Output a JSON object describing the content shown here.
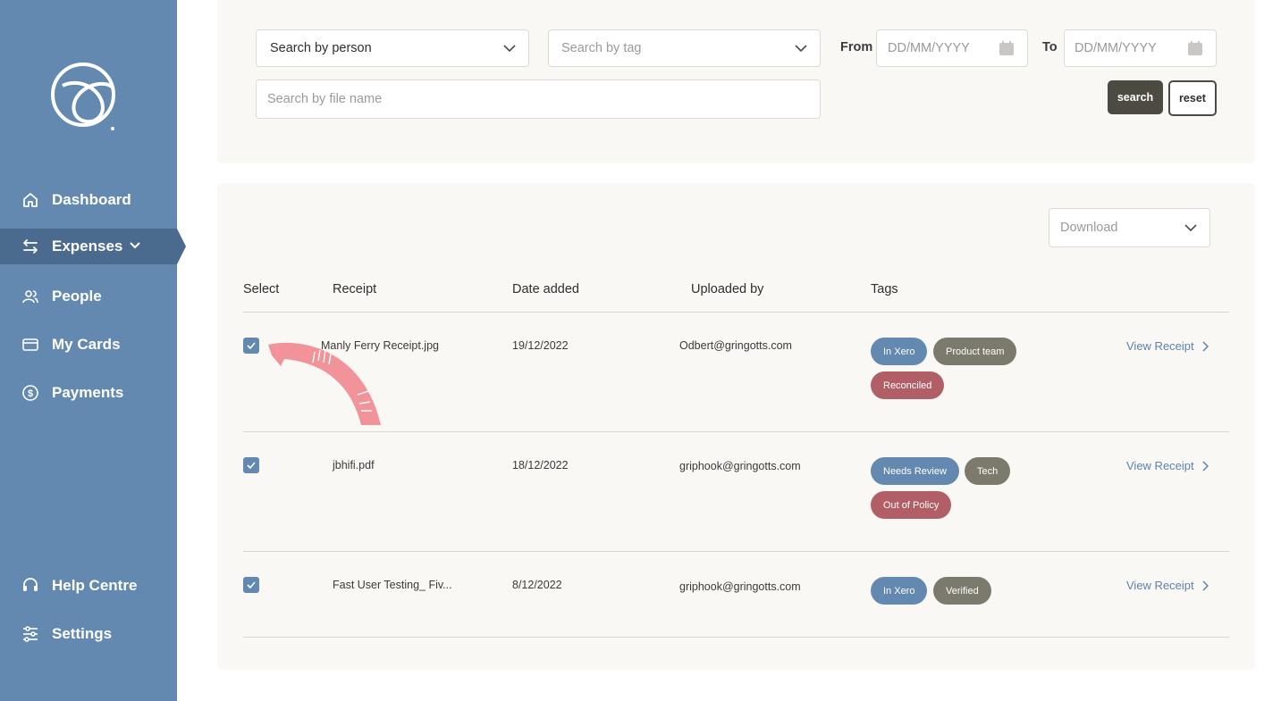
{
  "sidebar": {
    "nav": [
      {
        "label": "Dashboard",
        "icon": "home-icon"
      },
      {
        "label": "Expenses",
        "icon": "transfer-icon"
      },
      {
        "label": "People",
        "icon": "people-icon"
      },
      {
        "label": "My Cards",
        "icon": "card-icon"
      },
      {
        "label": "Payments",
        "icon": "dollar-circle-icon"
      }
    ],
    "bottom": [
      {
        "label": "Help Centre",
        "icon": "headset-icon"
      },
      {
        "label": "Settings",
        "icon": "sliders-icon"
      }
    ],
    "active": "Expenses"
  },
  "filters": {
    "person": {
      "value": "Search by person"
    },
    "tag": {
      "placeholder": "Search by tag"
    },
    "from_label": "From",
    "from_placeholder": "DD/MM/YYYY",
    "to_label": "To",
    "to_placeholder": "DD/MM/YYYY",
    "filename_placeholder": "Search by file name",
    "search_label": "search",
    "reset_label": "reset"
  },
  "table": {
    "download_placeholder": "Download",
    "headers": [
      "Select",
      "Receipt",
      "Date added",
      "Uploaded by",
      "Tags"
    ],
    "rows": [
      {
        "checked": true,
        "receipt": "Manly Ferry Receipt.jpg",
        "date": "19/12/2022",
        "uploaded_by": "Odbert@gringotts.com",
        "tags": [
          {
            "label": "In Xero",
            "color": "#6389b0"
          },
          {
            "label": "Product team",
            "color": "#7c7a6c"
          },
          {
            "label": "Reconciled",
            "color": "#b25e66"
          }
        ],
        "action": "View Receipt"
      },
      {
        "checked": true,
        "receipt": "jbhifi.pdf",
        "date": "18/12/2022",
        "uploaded_by": "griphook@gringotts.com",
        "tags": [
          {
            "label": "Needs Review",
            "color": "#6389b0"
          },
          {
            "label": "Tech",
            "color": "#7c7a6c"
          },
          {
            "label": "Out of Policy",
            "color": "#b25e66"
          }
        ],
        "action": "View Receipt"
      },
      {
        "checked": true,
        "receipt": "Fast User Testing_ Fiv...",
        "date": "8/12/2022",
        "uploaded_by": "griphook@gringotts.com",
        "tags": [
          {
            "label": "In Xero",
            "color": "#6389b0"
          },
          {
            "label": "Verified",
            "color": "#7c7a6c"
          }
        ],
        "action": "View Receipt"
      }
    ]
  },
  "colors": {
    "sidebar": "#6389b0",
    "sidebar_active": "#4b6b8e",
    "panel": "#faf8f4",
    "primary_button": "#4d4a42",
    "link": "#5b83ad",
    "annotation_arrow": "#f2939a"
  }
}
